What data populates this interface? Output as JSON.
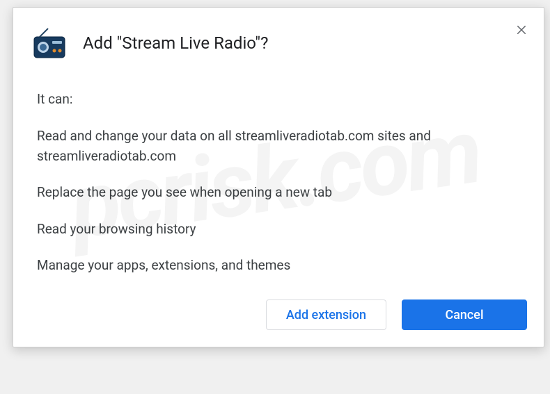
{
  "dialog": {
    "title": "Add \"Stream Live Radio\"?",
    "intro": "It can:",
    "permissions": [
      "Read and change your data on all streamliveradiotab.com sites and streamliveradiotab.com",
      "Replace the page you see when opening a new tab",
      "Read your browsing history",
      "Manage your apps, extensions, and themes"
    ],
    "buttons": {
      "add": "Add extension",
      "cancel": "Cancel"
    }
  },
  "watermark": "pcrisk.com"
}
